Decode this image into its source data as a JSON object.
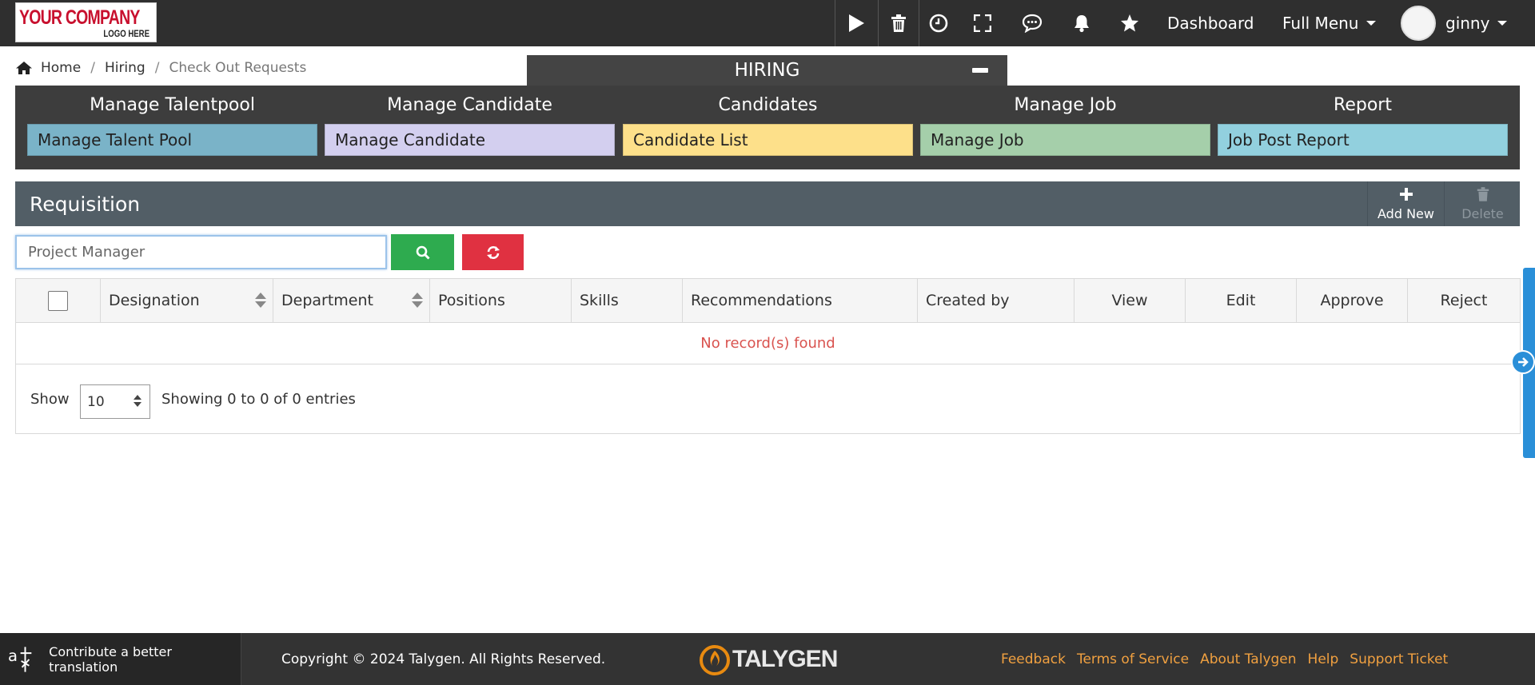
{
  "logo": {
    "line1": "YOUR COMPANY",
    "line2": "LOGO HERE"
  },
  "topbar": {
    "icons": [
      "play-icon",
      "trash-icon",
      "clock-icon",
      "fullscreen-icon",
      "chat-icon",
      "bell-icon",
      "star-icon"
    ],
    "dashboard": "Dashboard",
    "full_menu": "Full Menu",
    "user": "ginny"
  },
  "breadcrumb": {
    "home": "Home",
    "hiring": "Hiring",
    "current": "Check Out Requests"
  },
  "hiring": {
    "title": "HIRING",
    "columns": [
      {
        "title": "Manage Talentpool",
        "link": "Manage Talent Pool",
        "color": "#7ab3c8"
      },
      {
        "title": "Manage Candidate",
        "link": "Manage Candidate",
        "color": "#d3cfef"
      },
      {
        "title": "Candidates",
        "link": "Candidate List",
        "color": "#fde08a"
      },
      {
        "title": "Manage Job",
        "link": "Manage Job",
        "color": "#a5cfaa"
      },
      {
        "title": "Report",
        "link": "Job Post Report",
        "color": "#92d0de"
      }
    ]
  },
  "requisition": {
    "title": "Requisition",
    "add_new": "Add New",
    "delete": "Delete"
  },
  "search": {
    "placeholder": "Project Manager"
  },
  "table": {
    "columns": [
      "Designation",
      "Department",
      "Positions",
      "Skills",
      "Recommendations",
      "Created by",
      "View",
      "Edit",
      "Approve",
      "Reject"
    ],
    "empty": "No record(s) found",
    "show_label": "Show",
    "page_size": "10",
    "entries": "Showing 0 to 0 of 0 entries"
  },
  "footer": {
    "translate": "Contribute a better translation",
    "copyright": "Copyright © 2024 Talygen. All Rights Reserved.",
    "brand": "TALYGEN",
    "links": [
      "Feedback",
      "Terms of Service",
      "About Talygen",
      "Help",
      "Support Ticket"
    ]
  },
  "colors": {
    "topbar": "#2f2f2f",
    "accent_green": "#2eab4f",
    "accent_red": "#e03141",
    "link_orange": "#f0a040",
    "side_blue": "#2a8fd8"
  }
}
